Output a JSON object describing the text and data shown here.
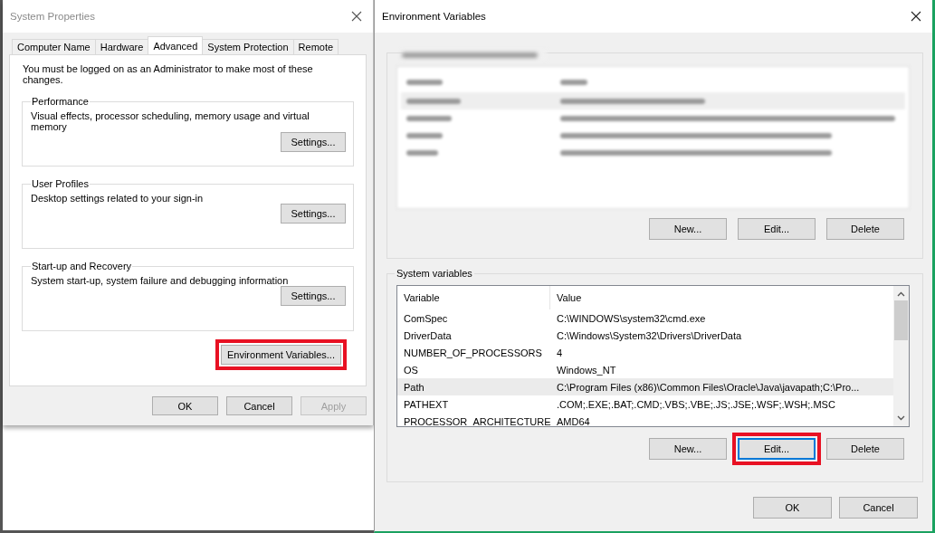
{
  "system_properties": {
    "title": "System Properties",
    "active": false,
    "tabs": [
      {
        "label": "Computer Name",
        "selected": false
      },
      {
        "label": "Hardware",
        "selected": false
      },
      {
        "label": "Advanced",
        "selected": true
      },
      {
        "label": "System Protection",
        "selected": false
      },
      {
        "label": "Remote",
        "selected": false
      }
    ],
    "notice": "You must be logged on as an Administrator to make most of these changes.",
    "groups": [
      {
        "title": "Performance",
        "description": "Visual effects, processor scheduling, memory usage and virtual memory",
        "button": "Settings..."
      },
      {
        "title": "User Profiles",
        "description": "Desktop settings related to your sign-in",
        "button": "Settings..."
      },
      {
        "title": "Start-up and Recovery",
        "description": "System start-up, system failure and debugging information",
        "button": "Settings..."
      }
    ],
    "env_button": {
      "label": "Environment Variables...",
      "highlighted": true
    },
    "buttons": [
      {
        "label": "OK",
        "disabled": false
      },
      {
        "label": "Cancel",
        "disabled": false
      },
      {
        "label": "Apply",
        "disabled": true
      }
    ]
  },
  "environment_variables": {
    "title": "Environment Variables",
    "active": true,
    "user_variables": {
      "buttons": [
        {
          "label": "New...",
          "highlighted": false,
          "focused": false
        },
        {
          "label": "Edit...",
          "highlighted": false,
          "focused": false
        },
        {
          "label": "Delete",
          "highlighted": false,
          "focused": false
        }
      ]
    },
    "system_variables": {
      "title": "System variables",
      "columns": [
        "Variable",
        "Value"
      ],
      "rows": [
        {
          "variable": "ComSpec",
          "value": "C:\\WINDOWS\\system32\\cmd.exe",
          "selected": false
        },
        {
          "variable": "DriverData",
          "value": "C:\\Windows\\System32\\Drivers\\DriverData",
          "selected": false
        },
        {
          "variable": "NUMBER_OF_PROCESSORS",
          "value": "4",
          "selected": false
        },
        {
          "variable": "OS",
          "value": "Windows_NT",
          "selected": false
        },
        {
          "variable": "Path",
          "value": "C:\\Program Files (x86)\\Common Files\\Oracle\\Java\\javapath;C:\\Pro...",
          "selected": true
        },
        {
          "variable": "PATHEXT",
          "value": ".COM;.EXE;.BAT;.CMD;.VBS;.VBE;.JS;.JSE;.WSF;.WSH;.MSC",
          "selected": false
        },
        {
          "variable": "PROCESSOR_ARCHITECTURE",
          "value": "AMD64",
          "selected": false
        }
      ],
      "buttons": [
        {
          "label": "New...",
          "highlighted": false,
          "focused": false
        },
        {
          "label": "Edit...",
          "highlighted": true,
          "focused": true
        },
        {
          "label": "Delete",
          "highlighted": false,
          "focused": false
        }
      ]
    },
    "buttons": [
      {
        "label": "OK"
      },
      {
        "label": "Cancel"
      }
    ]
  }
}
